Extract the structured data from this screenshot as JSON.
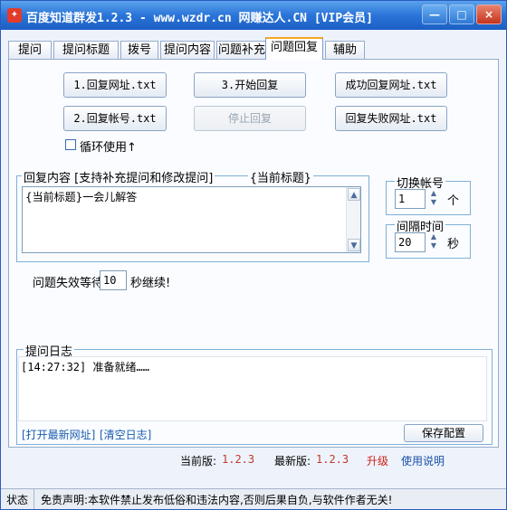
{
  "window": {
    "title": "百度知道群发1.2.3 - www.wzdr.cn 网赚达人.CN [VIP会员]",
    "controls": {
      "minimize": "—",
      "maximize": "□",
      "close": "×"
    }
  },
  "tabs": [
    {
      "label": "提问"
    },
    {
      "label": "提问标题"
    },
    {
      "label": "拨号"
    },
    {
      "label": "提问内容"
    },
    {
      "label": "问题补充"
    },
    {
      "label": "问题回复"
    },
    {
      "label": "辅助"
    }
  ],
  "buttons": {
    "reply_url": "1.回复网址.txt",
    "start_reply": "3.开始回复",
    "success_url": "成功回复网址.txt",
    "reply_account": "2.回复帐号.txt",
    "stop_reply": "停止回复",
    "fail_url": "回复失败网址.txt"
  },
  "loop": {
    "label": "循环使用↑",
    "checked": false
  },
  "reply_content": {
    "legend": "回复内容 [支持补充提问和修改提问]",
    "legend_tag": "{当前标题}",
    "text": "{当前标题}一会儿解答"
  },
  "switch_account": {
    "legend": "切换帐号",
    "value": "1",
    "unit": "个"
  },
  "interval": {
    "legend": "间隔时间",
    "value": "20",
    "unit": "秒"
  },
  "fail_wait": {
    "prefix": "问题失效等待",
    "value": "10",
    "suffix": "秒继续!"
  },
  "log": {
    "legend": "提问日志",
    "lines": [
      "[14:27:32] 准备就绪……"
    ],
    "open_latest": "[打开最新网址]",
    "clear": "[清空日志]",
    "save": "保存配置"
  },
  "version": {
    "current_label": "当前版:",
    "current_value": "1.2.3",
    "latest_label": "最新版:",
    "latest_value": "1.2.3",
    "upgrade": "升级",
    "help": "使用说明"
  },
  "statusbar": {
    "label": "状态",
    "message": "免责声明:本软件禁止发布低俗和违法内容,否则后果自负,与软件作者无关!"
  },
  "colors": {
    "titlebar": "#2a74d8",
    "link": "#1a5cb0",
    "version_value": "#c0392b",
    "upgrade": "#d0201a",
    "active_tab_accent": "#f5a623"
  }
}
